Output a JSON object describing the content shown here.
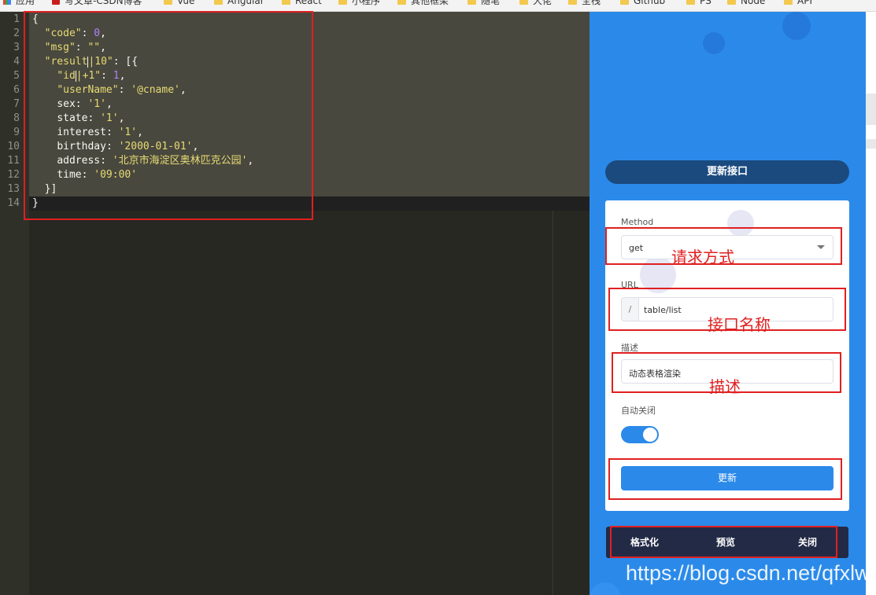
{
  "bookmarks": [
    {
      "label": "应用",
      "icon": "apps-icon"
    },
    {
      "label": "写文章-CSDN博客",
      "icon": "csdn-icon"
    },
    {
      "label": "Vue",
      "icon": "folder-icon"
    },
    {
      "label": "Angular",
      "icon": "folder-icon"
    },
    {
      "label": "React",
      "icon": "folder-icon"
    },
    {
      "label": "小程序",
      "icon": "folder-icon"
    },
    {
      "label": "其他框架",
      "icon": "folder-icon"
    },
    {
      "label": "随笔",
      "icon": "folder-icon"
    },
    {
      "label": "大佬",
      "icon": "folder-icon"
    },
    {
      "label": "全栈",
      "icon": "folder-icon"
    },
    {
      "label": "Github",
      "icon": "folder-icon"
    },
    {
      "label": "PS",
      "icon": "folder-icon"
    },
    {
      "label": "Node",
      "icon": "folder-icon"
    },
    {
      "label": "API",
      "icon": "folder-icon"
    }
  ],
  "editor": {
    "line_numbers": [
      "1",
      "2",
      "3",
      "4",
      "5",
      "6",
      "7",
      "8",
      "9",
      "10",
      "11",
      "12",
      "13",
      "14"
    ],
    "lines": {
      "l1": "{",
      "l2_key": "\"code\"",
      "l2_val": "0",
      "l3_key": "\"msg\"",
      "l3_val": "\"\"",
      "l4_key_a": "\"result",
      "l4_key_b": "|10\"",
      "l5_key_a": "\"id",
      "l5_key_b": "|+1\"",
      "l5_val": "1",
      "l6_key": "\"userName\"",
      "l6_val": "'@cname'",
      "l7_key": "sex",
      "l7_val": "'1'",
      "l8_key": "state",
      "l8_val": "'1'",
      "l9_key": "interest",
      "l9_val": "'1'",
      "l10_key": "birthday",
      "l10_val": "'2000-01-01'",
      "l11_key": "address",
      "l11_val": "'北京市海淀区奥林匹克公园'",
      "l12_key": "time",
      "l12_val": "'09:00'",
      "l13": "}]",
      "l14": "}"
    }
  },
  "panel": {
    "title_button": "更新接口",
    "method_label": "Method",
    "method_value": "get",
    "url_label": "URL",
    "url_prefix": "/",
    "url_value": "table/list",
    "desc_label": "描述",
    "desc_value": "动态表格渲染",
    "auto_close_label": "自动关闭",
    "auto_close_on": true,
    "update_button": "更新",
    "actions": {
      "format": "格式化",
      "preview": "预览",
      "close": "关闭"
    },
    "accent": "#2b8ae9",
    "dark": "#232a46"
  },
  "annotations": {
    "method": "请求方式",
    "url": "接口名称",
    "desc": "描述"
  },
  "watermark": "https://blog.csdn.net/qfxlw"
}
